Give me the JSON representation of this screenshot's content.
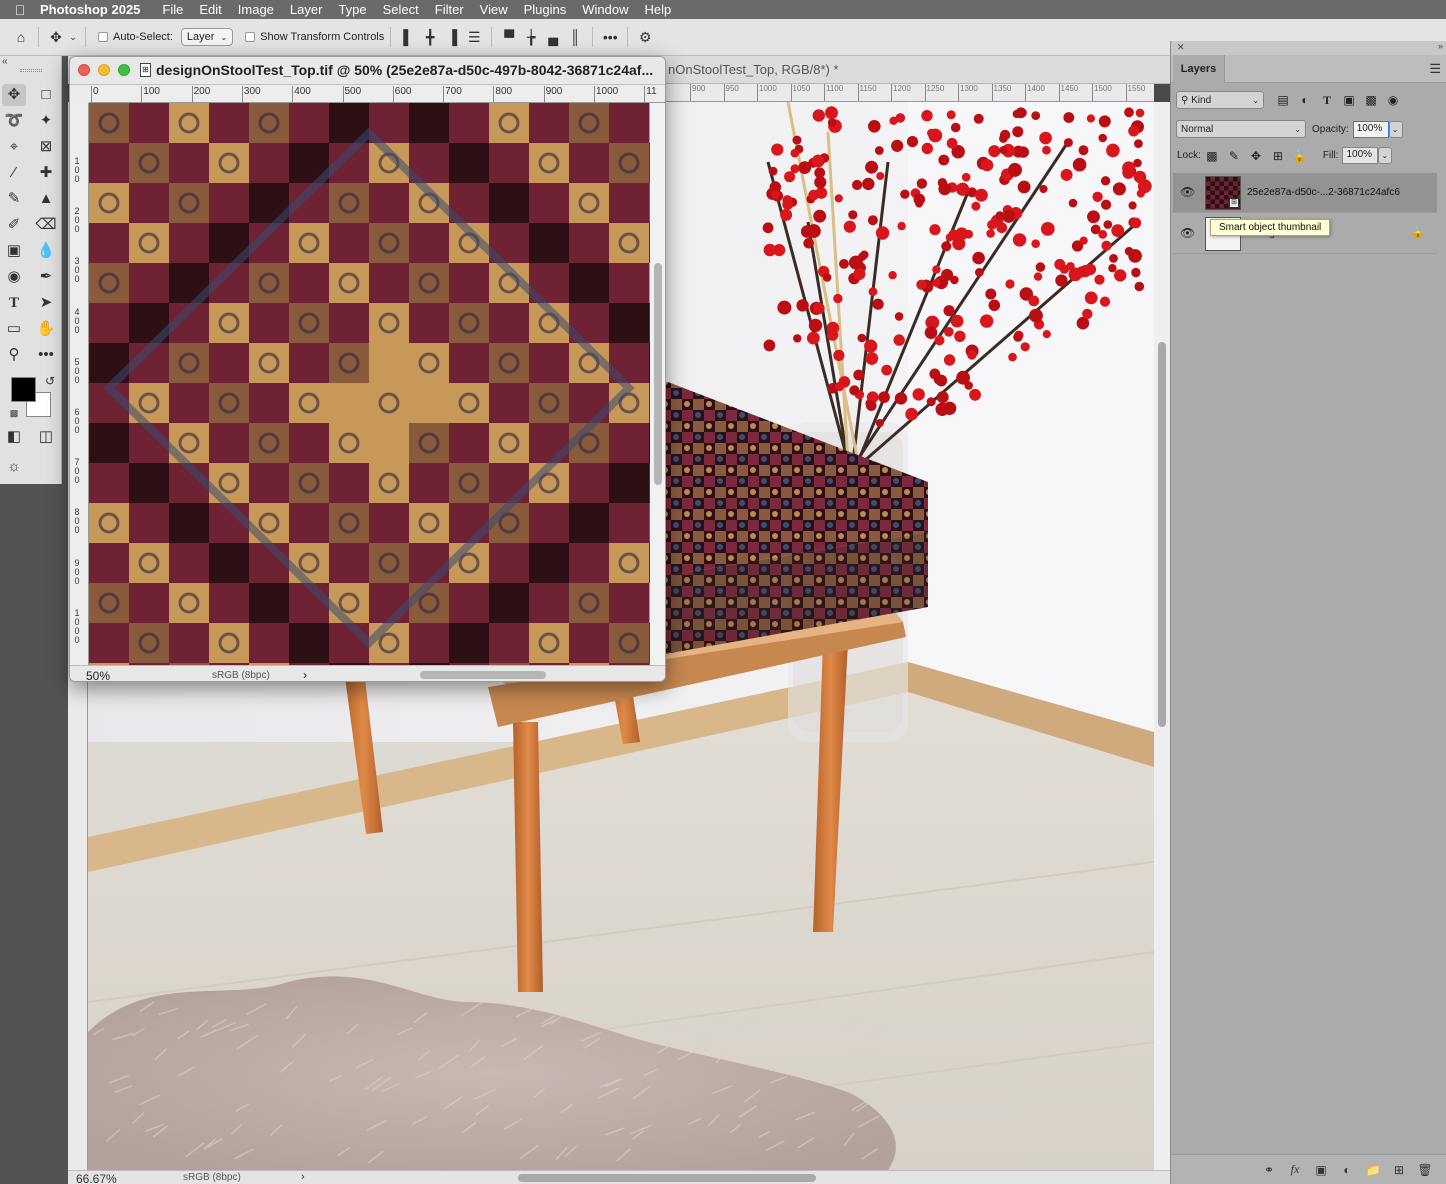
{
  "menubar": {
    "app_name": "Photoshop 2025",
    "items": [
      "File",
      "Edit",
      "Image",
      "Layer",
      "Type",
      "Select",
      "Filter",
      "View",
      "Plugins",
      "Window",
      "Help"
    ]
  },
  "options_bar": {
    "auto_select_label": "Auto-Select:",
    "auto_select_value": "Layer",
    "transform_label": "Show Transform Controls"
  },
  "main_document": {
    "tab_title": "nOnStoolTest_Top, RGB/8*) *",
    "zoom": "66.67%",
    "profile": "sRGB (8bpc)",
    "ruler_labels": [
      "900",
      "950",
      "1000",
      "1050",
      "1100",
      "1150",
      "1200",
      "1250",
      "1300",
      "1350",
      "1400",
      "1450",
      "1500",
      "1550"
    ]
  },
  "float_document": {
    "title": "designOnStoolTest_Top.tif @ 50% (25e2e87a-d50c-497b-8042-36871c24af...",
    "zoom": "50%",
    "profile": "sRGB (8bpc)",
    "ruler_labels": [
      "0",
      "100",
      "200",
      "300",
      "400",
      "500",
      "600",
      "700",
      "800",
      "900",
      "1000",
      "11"
    ],
    "vruler_labels": [
      "1\n0\n0",
      "2\n0\n0",
      "3\n0\n0",
      "4\n0\n0",
      "5\n0\n0",
      "6\n0\n0",
      "7\n0\n0",
      "8\n0\n0",
      "9\n0\n0",
      "1\n0\n0\n0"
    ]
  },
  "layers_panel": {
    "tab_label": "Layers",
    "filter_kind": "Kind",
    "blend_mode": "Normal",
    "opacity_label": "Opacity:",
    "opacity_value": "100%",
    "lock_label": "Lock:",
    "fill_label": "Fill:",
    "fill_value": "100%",
    "layers": [
      {
        "name": "25e2e87a-d50c-...2-36871c24afc6",
        "visible": true,
        "selected": true,
        "type": "smart-object"
      },
      {
        "name": "Background",
        "visible": true,
        "selected": false,
        "locked": true
      }
    ],
    "tooltip": "Smart object thumbnail"
  },
  "colors": {
    "foreground": "#000000",
    "background": "#ffffff",
    "accent": "#3b7ae0"
  }
}
